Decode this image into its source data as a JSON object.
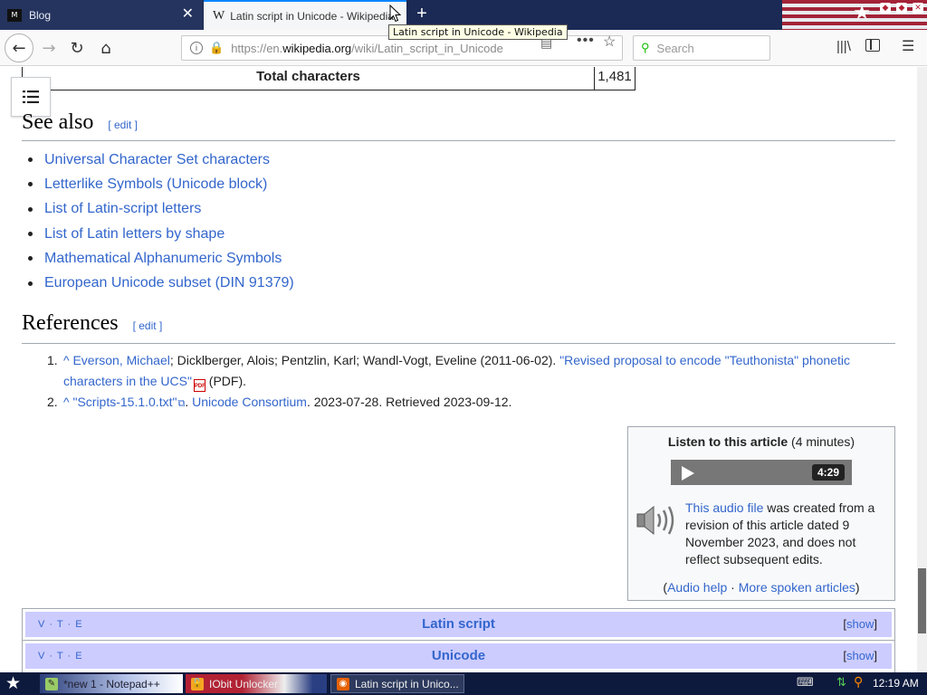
{
  "browser": {
    "tabs": [
      {
        "label": "Blog",
        "favicon": "M"
      },
      {
        "label": "Latin script in Unicode - Wikipedia",
        "favicon": "W"
      }
    ],
    "tooltip": "Latin script in Unicode - Wikipedia",
    "url_prefix": "https://en.",
    "url_host": "wikipedia.org",
    "url_path": "/wiki/Latin_script_in_Unicode",
    "search_placeholder": "Search"
  },
  "page": {
    "total_table": {
      "label": "Total characters",
      "value": "1,481"
    },
    "see_also": {
      "heading": "See also",
      "edit": "[ edit ]",
      "items": [
        "Universal Character Set characters",
        "Letterlike Symbols (Unicode block)",
        "List of Latin-script letters",
        "List of Latin letters by shape",
        "Mathematical Alphanumeric Symbols",
        "European Unicode subset (DIN 91379)"
      ]
    },
    "references": {
      "heading": "References",
      "edit": "[ edit ]",
      "items": [
        {
          "num": "1.",
          "caret": "^",
          "author_link": "Everson, Michael",
          "authors_rest": "; Dicklberger, Alois; Pentzlin, Karl; Wandl-Vogt, Eveline (2011-06-02). ",
          "title_link": "\"Revised proposal to encode \"Teuthonista\" phonetic characters in the UCS\"",
          "pdf_label": "PDF",
          "suffix": " (PDF)."
        },
        {
          "num": "2.",
          "caret": "^",
          "title_link": "\"Scripts-15.1.0.txt\"",
          "sep": ". ",
          "publisher_link": "Unicode Consortium",
          "rest": ". 2023-07-28. Retrieved 2023-09-12."
        }
      ]
    },
    "audio": {
      "title_bold": "Listen to this article",
      "title_rest": " (4 minutes)",
      "duration": "4:29",
      "desc_link": "This audio file",
      "desc_rest": " was created from a revision of this article dated 9 November 2023, and does not reflect subsequent edits.",
      "footer_open": "(",
      "help_link": "Audio help",
      "sep": " · ",
      "more_link": "More spoken articles",
      "footer_close": ")"
    },
    "navboxes": [
      {
        "vte": "V · T · E",
        "title": "Latin script",
        "show": "show"
      },
      {
        "vte": "V · T · E",
        "title": "Unicode",
        "show": "show"
      }
    ]
  },
  "taskbar": {
    "tasks": [
      {
        "label": "*new 1 - Notepad++"
      },
      {
        "label": "IObit Unlocker"
      },
      {
        "label": "Latin script in Unico..."
      }
    ],
    "clock": "12:19 AM"
  }
}
